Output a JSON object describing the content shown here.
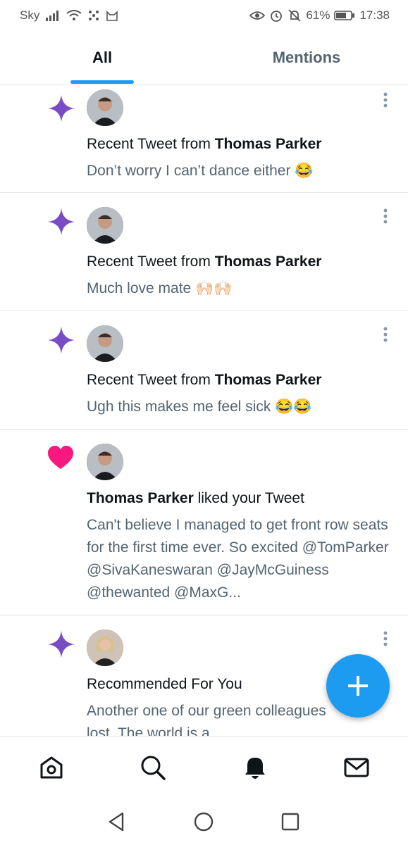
{
  "status_bar": {
    "carrier": "Sky",
    "battery": "61%",
    "time": "17:38",
    "icons": [
      "signal-icon",
      "wifi-icon",
      "dots-icon",
      "cat-icon",
      "eye-icon",
      "alarm-icon",
      "bell-off-icon",
      "battery-icon"
    ]
  },
  "tabs": [
    {
      "label": "All",
      "active": true
    },
    {
      "label": "Mentions",
      "active": false
    }
  ],
  "notifications": [
    {
      "type": "recent-tweet",
      "icon": "sparkle-icon",
      "prefix": "Recent Tweet from ",
      "name": "Thomas Parker",
      "suffix": "",
      "body": "Don’t worry I can’t dance either 😂"
    },
    {
      "type": "recent-tweet",
      "icon": "sparkle-icon",
      "prefix": "Recent Tweet from ",
      "name": "Thomas Parker",
      "suffix": "",
      "body": "Much love mate 🙌🏻🙌🏻"
    },
    {
      "type": "recent-tweet",
      "icon": "sparkle-icon",
      "prefix": "Recent Tweet from ",
      "name": "Thomas Parker",
      "suffix": "",
      "body": "Ugh this makes me feel sick 😂😂"
    },
    {
      "type": "like",
      "icon": "heart-icon",
      "prefix": "",
      "name": "Thomas Parker",
      "suffix": " liked your Tweet",
      "body": "Can't believe I managed to get front row seats for the first time ever. So excited @TomParker @SivaKaneswaran @JayMcGuiness @thewanted @MaxG..."
    },
    {
      "type": "recommended",
      "icon": "sparkle-icon",
      "prefix": "Recommended For You",
      "name": "",
      "suffix": "",
      "body": "Another one of our green colleagues lost. The world is a"
    }
  ],
  "colors": {
    "accent": "#1d9bf0",
    "sparkle": "#794bc4",
    "heart": "#f91880",
    "secondary_text": "#536471"
  },
  "bottom_nav": [
    "home-icon",
    "search-icon",
    "notifications-icon",
    "messages-icon"
  ],
  "system_nav": [
    "back-icon",
    "home-circle-icon",
    "recents-icon"
  ]
}
